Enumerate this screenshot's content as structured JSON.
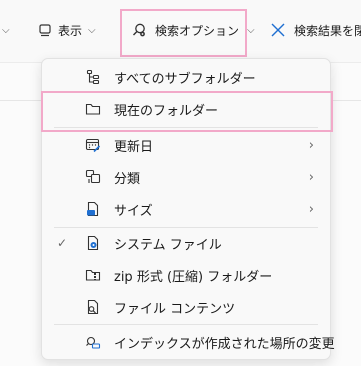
{
  "toolbar": {
    "view_label": "表示",
    "search_options_label": "検索オプション",
    "close_search_label": "検索結果を閉"
  },
  "menu": {
    "items": [
      {
        "label": "すべてのサブフォルダー",
        "icon": "subfolders-icon",
        "checked": false,
        "submenu": false
      },
      {
        "label": "現在のフォルダー",
        "icon": "folder-icon",
        "checked": false,
        "submenu": false
      },
      {
        "label": "更新日",
        "icon": "calendar-icon",
        "checked": false,
        "submenu": true
      },
      {
        "label": "分類",
        "icon": "category-icon",
        "checked": false,
        "submenu": true
      },
      {
        "label": "サイズ",
        "icon": "size-icon",
        "checked": false,
        "submenu": true
      },
      {
        "label": "システム ファイル",
        "icon": "system-file-icon",
        "checked": true,
        "submenu": false
      },
      {
        "label": "zip 形式 (圧縮) フォルダー",
        "icon": "zip-folder-icon",
        "checked": false,
        "submenu": false
      },
      {
        "label": "ファイル コンテンツ",
        "icon": "file-search-icon",
        "checked": false,
        "submenu": false
      },
      {
        "label": "インデックスが作成された場所の変更",
        "icon": "index-locations-icon",
        "checked": false,
        "submenu": false
      }
    ]
  }
}
